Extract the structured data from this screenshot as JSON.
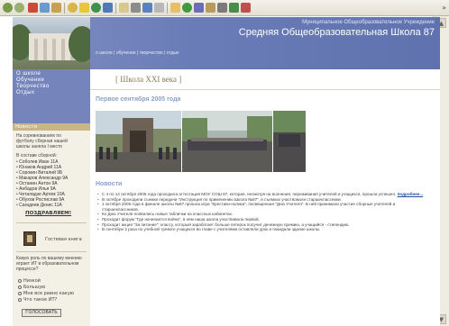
{
  "header": {
    "subtitle": "Муниципальное Общеобразовательное Учреждение",
    "title": "Средняя Общеобразовательная Школа  87"
  },
  "breadcrumb": "о школе | обучение | творчество | отдых",
  "nav": {
    "items": [
      "О школе",
      "Обучение",
      "Творчество",
      "Отдых"
    ]
  },
  "school_label": "[ Школа XXI века ]",
  "first_september": {
    "title": "Первое сентября 2005 года"
  },
  "left": {
    "section_label": "Новости",
    "intro": "На соревнованиях по футболу сборная нашей школы заняла I место",
    "team_label": "В составе сборной:",
    "team": [
      "Соболев Иван 11А",
      "Юнаков Андрей 11А",
      "Сорокин Виталий 9Б",
      "Макаров Александр 9А",
      "Останин Антон 9А",
      "Анбадов Илья 9А",
      "Четаладзе Артем 10А",
      "Обухов Ростислав 9А",
      "Сагадеев Денис 11А"
    ],
    "congrats": "ПОЗДРАВЛЯЕМ!",
    "guestbook": "Гостевая книга",
    "poll_question": "Какую роль по вашему мнению играет ИТ в образовательном процессе?",
    "poll_options": [
      "Низкой",
      "Большую",
      "Мне все равно какую",
      "Что такое ИТ?"
    ],
    "vote_button": "ГОЛОСОВАТЬ"
  },
  "news": {
    "title": "Новости",
    "items": [
      "С 4 по 14 октября 2005 года проходила аттестация МОУ СОШ 87, которая, несмотря на волнения, переживания учителей и учащихся, прошла успешно.",
      "В октябре проходили съемки передачи \"Инструкция по применению Школа №87\", в съемках участвовали старшеклассники.",
      "1 октября 2005 года в финале школы №87 прошла игра \"Крестики-нолики\", посвященная \"Дню Учителя\". В ней принимали участие сборные учителей и старшеклассников.",
      "Ко Дню Учителя появились новые таблички на классных кабинетах.",
      "Проходит форум \"Где начинается война\", в нем наша школа участвовала первой.",
      "Проходит акция \"За питание\": классу, который заработает больше петерок получит денежную премию, а учащийся - стипендию.",
      "В сентябре 2 раза по учебной тревоге учащихся во главе с учителями оставляли урок и покидали здание школы."
    ],
    "more_link": "подробнее..."
  },
  "colors": {
    "header_blue": "#6b7db8",
    "section_title": "#8aa2c8",
    "accent_tan": "#c8b68a"
  }
}
